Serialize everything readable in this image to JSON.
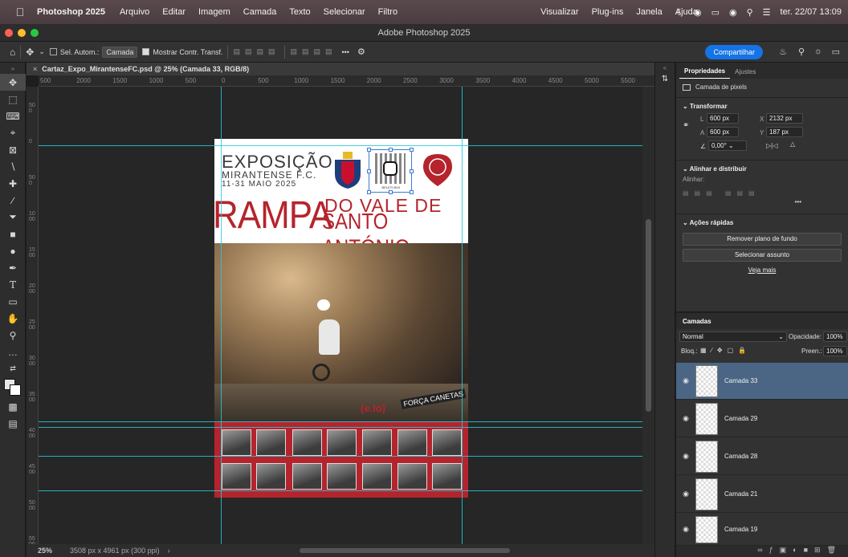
{
  "menubar": {
    "app": "Photoshop 2025",
    "items": [
      "Arquivo",
      "Editar",
      "Imagem",
      "Camada",
      "Texto",
      "Selecionar",
      "Filtro",
      "Visualizar",
      "Plug-ins",
      "Janela",
      "Ajuda"
    ],
    "clock": "ter. 22/07  13:09"
  },
  "titlebar": {
    "title": "Adobe Photoshop 2025"
  },
  "options": {
    "auto_select_label": "Sel. Autom.:",
    "auto_select_target": "Camada",
    "show_transform_label": "Mostrar Contr. Transf.",
    "more": "•••",
    "share_label": "Compartilhar"
  },
  "document": {
    "tab_title": "Cartaz_Expo_MirantenseFC.psd @ 25% (Camada 33, RGB/8)",
    "ruler_top_labels": [
      "500",
      "2000",
      "1500",
      "1000",
      "500",
      "0",
      "500",
      "1000",
      "1500",
      "2000",
      "2500",
      "3000",
      "3500",
      "4000",
      "4500",
      "5000",
      "5500"
    ],
    "ruler_left_labels": [
      "500",
      "0",
      "500",
      "1000",
      "1500",
      "2000",
      "2500",
      "3000",
      "3500",
      "4000",
      "4500",
      "5000",
      "5500"
    ],
    "zoom": "25%",
    "doc_info": "3508 px x 4961 px (300 ppi)"
  },
  "poster": {
    "title_line1": "EXPOSIÇÃO",
    "title_line2": "MIRANTENSE F.C.",
    "dates": "11-31 MAIO 2025",
    "big_left": "RAMPA",
    "big_right_line1": "DO VALE DE",
    "big_right_line2": "SANTO ANTÓNIO",
    "qr_caption": "BELETI.BXX",
    "signature": "(e.lo)",
    "banner": "FORÇA CANETAS"
  },
  "properties_panel": {
    "tabs": [
      "Propriedades",
      "Ajustes"
    ],
    "layer_kind": "Camada de pixels",
    "transform": {
      "title": "Transformar",
      "L": "600 px",
      "A": "600 px",
      "X": "2132 px",
      "Y": "187 px",
      "angle": "0,00°"
    },
    "align": {
      "title": "Alinhar e distribuir",
      "label": "Alinhar:",
      "more": "•••"
    },
    "quick_actions": {
      "title": "Ações rápidas",
      "remove_bg": "Remover plano de fundo",
      "select_subject": "Selecionar assunto",
      "see_more": "Veja mais"
    }
  },
  "layers_panel": {
    "title": "Camadas",
    "blend_mode": "Normal",
    "opacity_label": "Opacidade:",
    "opacity": "100%",
    "lock_label": "Bloq.:",
    "fill_label": "Preen.:",
    "fill": "100%",
    "layers": [
      {
        "name": "Camada 33",
        "selected": true
      },
      {
        "name": "Camada 29",
        "selected": false
      },
      {
        "name": "Camada 28",
        "selected": false
      },
      {
        "name": "Camada 21",
        "selected": false
      },
      {
        "name": "Camada 19",
        "selected": false
      }
    ]
  },
  "colors": {
    "accent": "#1473e6",
    "guide": "#27c9d8",
    "poster_red": "#b5242c",
    "selected_layer": "#4a6684"
  }
}
